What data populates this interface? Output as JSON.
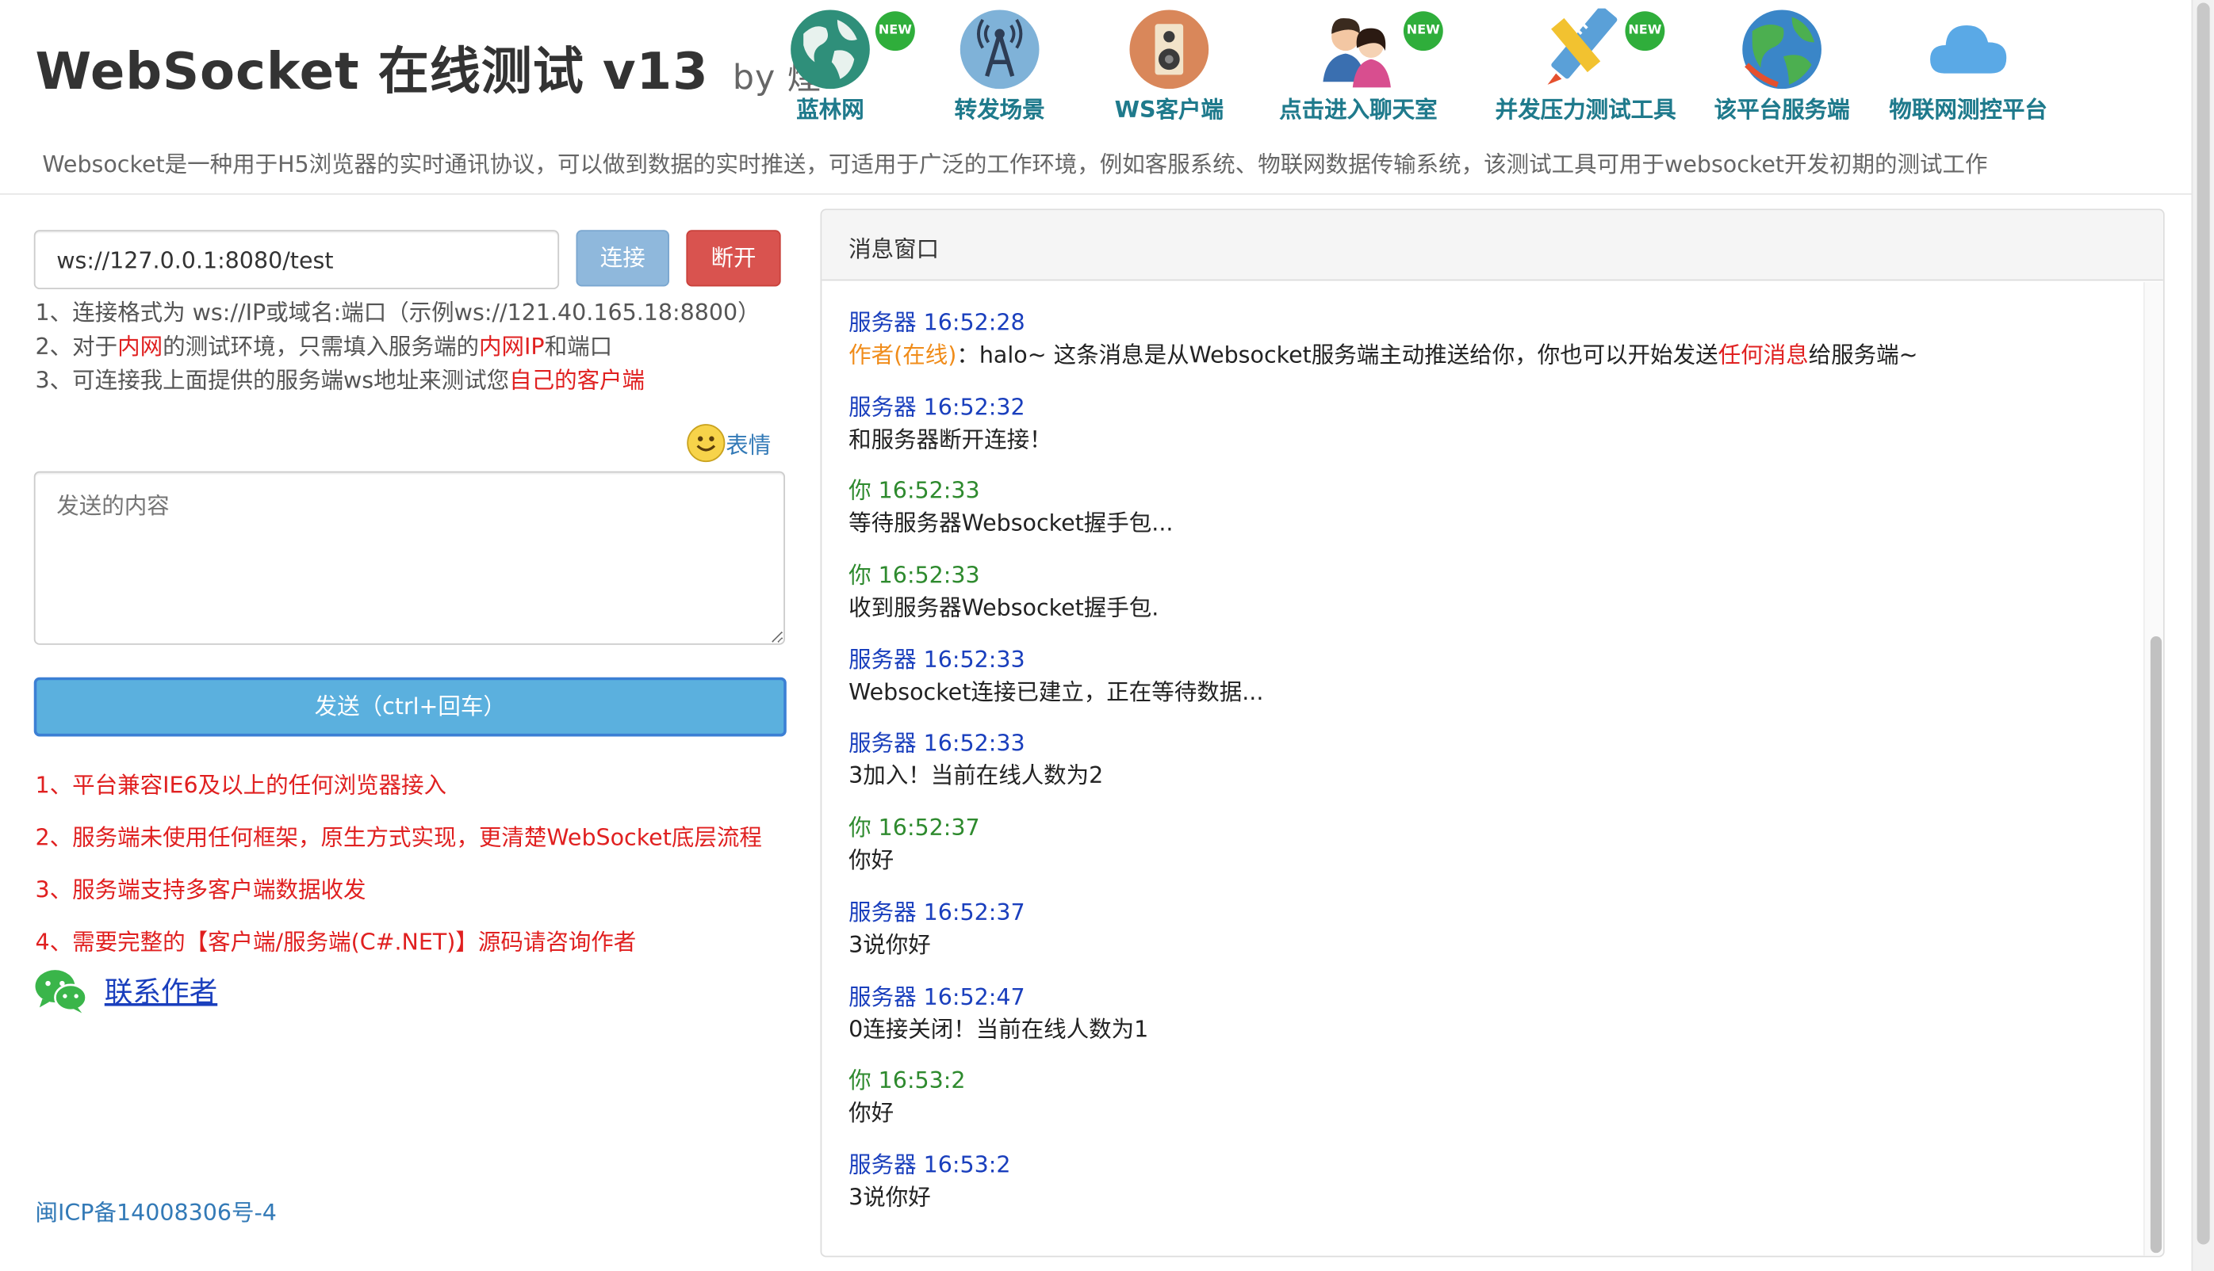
{
  "header": {
    "title": "WebSocket 在线测试 v13",
    "by": "by 煌",
    "description": "Websocket是一种用于H5浏览器的实时通讯协议，可以做到数据的实时推送，可适用于广泛的工作环境，例如客服系统、物联网数据传输系统，该测试工具可用于websocket开发初期的测试工作",
    "nav": [
      {
        "label": "蓝林网",
        "icon": "globe-icon",
        "new": true
      },
      {
        "label": "转发场景",
        "icon": "antenna-icon",
        "new": false
      },
      {
        "label": "WS客户端",
        "icon": "speaker-icon",
        "new": false
      },
      {
        "label": "点击进入聊天室",
        "icon": "people-icon",
        "new": true
      },
      {
        "label": "并发压力测试工具",
        "icon": "pencil-ruler-icon",
        "new": true
      },
      {
        "label": "该平台服务端",
        "icon": "earth-icon",
        "new": false
      },
      {
        "label": "物联网测控平台",
        "icon": "cloud-icon",
        "new": false
      }
    ],
    "new_badge": "NEW"
  },
  "connection": {
    "url_value": "ws://127.0.0.1:8080/test",
    "connect_label": "连接",
    "disconnect_label": "断开"
  },
  "tips": {
    "line1": "1、连接格式为 ws://IP或域名:端口（示例ws://121.40.165.18:8800）",
    "line2_a": "2、对于",
    "line2_b": "内网",
    "line2_c": "的测试环境，只需填入服务端的",
    "line2_d": "内网IP",
    "line2_e": "和端口",
    "line3_a": "3、可连接我上面提供的服务端ws地址来测试您",
    "line3_b": "自己的客户端"
  },
  "emoji_label": "表情",
  "send": {
    "placeholder": "发送的内容",
    "button_label": "发送（ctrl+回车）"
  },
  "features": [
    "1、平台兼容IE6及以上的任何浏览器接入",
    "2、服务端未使用任何框架，原生方式实现，更清楚WebSocket底层流程",
    "3、服务端支持多客户端数据收发",
    "4、需要完整的【客户端/服务端(C#.NET)】源码请咨询作者"
  ],
  "contact_label": "联系作者",
  "icp": "闽ICP备14008306号-4",
  "messages_panel": {
    "title": "消息窗口",
    "messages": [
      {
        "sender": "server",
        "meta": "服务器 16:52:28",
        "parts": [
          {
            "t": "作者(在线)",
            "c": "orange"
          },
          {
            "t": "：halo~ 这条消息是从Websocket服务端主动推送给你，你也可以开始发送",
            "c": ""
          },
          {
            "t": "任何消息",
            "c": "red"
          },
          {
            "t": "给服务端~",
            "c": ""
          }
        ]
      },
      {
        "sender": "server",
        "meta": "服务器 16:52:32",
        "parts": [
          {
            "t": "和服务器断开连接！",
            "c": ""
          }
        ]
      },
      {
        "sender": "you",
        "meta": "你 16:52:33",
        "parts": [
          {
            "t": "等待服务器Websocket握手包...",
            "c": ""
          }
        ]
      },
      {
        "sender": "you",
        "meta": "你 16:52:33",
        "parts": [
          {
            "t": "收到服务器Websocket握手包.",
            "c": ""
          }
        ]
      },
      {
        "sender": "server",
        "meta": "服务器 16:52:33",
        "parts": [
          {
            "t": "Websocket连接已建立，正在等待数据...",
            "c": ""
          }
        ]
      },
      {
        "sender": "server",
        "meta": "服务器 16:52:33",
        "parts": [
          {
            "t": "3加入！当前在线人数为2",
            "c": ""
          }
        ]
      },
      {
        "sender": "you",
        "meta": "你 16:52:37",
        "parts": [
          {
            "t": "你好",
            "c": ""
          }
        ]
      },
      {
        "sender": "server",
        "meta": "服务器 16:52:37",
        "parts": [
          {
            "t": "3说你好",
            "c": ""
          }
        ]
      },
      {
        "sender": "server",
        "meta": "服务器 16:52:47",
        "parts": [
          {
            "t": "0连接关闭！当前在线人数为1",
            "c": ""
          }
        ]
      },
      {
        "sender": "you",
        "meta": "你 16:53:2",
        "parts": [
          {
            "t": "你好",
            "c": ""
          }
        ]
      },
      {
        "sender": "server",
        "meta": "服务器 16:53:2",
        "parts": [
          {
            "t": "3说你好",
            "c": ""
          }
        ]
      }
    ]
  }
}
